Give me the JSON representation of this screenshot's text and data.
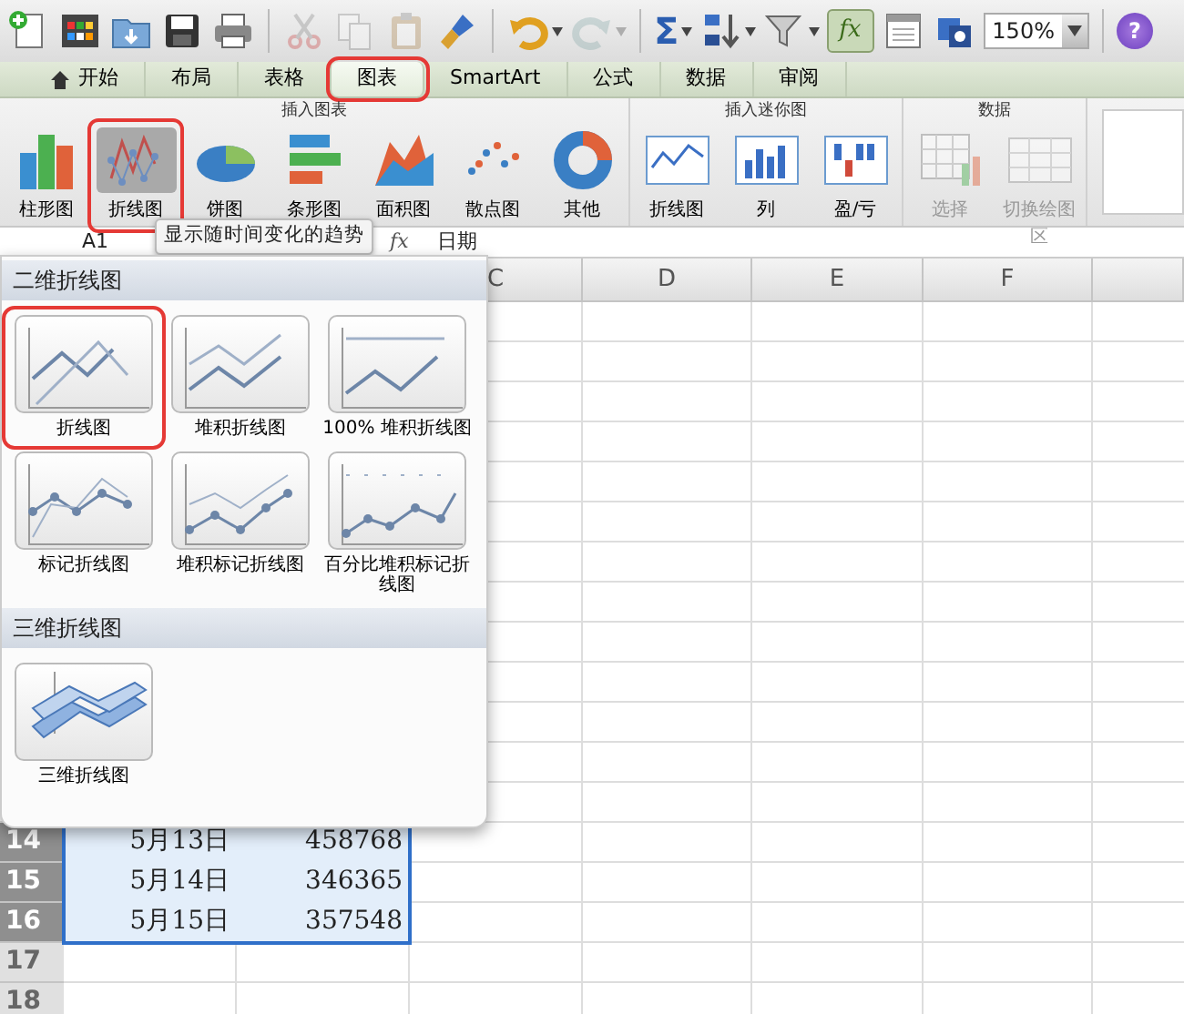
{
  "toolbar": [
    {
      "kind": "icon",
      "disabled": false,
      "dropdown": false
    },
    {
      "kind": "icon",
      "disabled": false,
      "dropdown": false
    },
    {
      "kind": "icon",
      "disabled": false,
      "dropdown": false
    },
    {
      "kind": "icon",
      "disabled": false,
      "dropdown": false
    },
    {
      "kind": "icon",
      "disabled": false,
      "dropdown": false
    },
    {
      "kind": "separator"
    },
    {
      "kind": "icon",
      "disabled": true,
      "dropdown": false
    },
    {
      "kind": "icon",
      "disabled": true,
      "dropdown": false
    },
    {
      "kind": "icon",
      "disabled": true,
      "dropdown": false
    },
    {
      "kind": "icon",
      "disabled": false,
      "dropdown": false
    },
    {
      "kind": "separator"
    },
    {
      "kind": "icon",
      "disabled": false,
      "dropdown": true
    },
    {
      "kind": "icon",
      "disabled": true,
      "dropdown": true
    },
    {
      "kind": "separator"
    },
    {
      "kind": "symbol",
      "text": "Σ",
      "dropdown": true
    },
    {
      "kind": "icon",
      "disabled": false,
      "dropdown": true
    },
    {
      "kind": "icon",
      "disabled": false,
      "dropdown": true
    },
    {
      "kind": "toggle",
      "text": "fx",
      "on": true
    },
    {
      "kind": "icon",
      "disabled": false,
      "dropdown": false
    },
    {
      "kind": "icon",
      "disabled": false,
      "dropdown": false
    },
    {
      "kind": "zoom",
      "value": "150%"
    },
    {
      "kind": "separator"
    },
    {
      "kind": "help",
      "text": "?"
    }
  ],
  "tabs": [
    {
      "label": "开始",
      "selected": false,
      "annotated": false
    },
    {
      "label": "布局",
      "selected": false,
      "annotated": false
    },
    {
      "label": "表格",
      "selected": false,
      "annotated": false
    },
    {
      "label": "图表",
      "selected": true,
      "annotated": true
    },
    {
      "label": "SmartArt",
      "selected": false,
      "annotated": false
    },
    {
      "label": "公式",
      "selected": false,
      "annotated": false
    },
    {
      "label": "数据",
      "selected": false,
      "annotated": false
    },
    {
      "label": "审阅",
      "selected": false,
      "annotated": false
    }
  ],
  "ribbon": {
    "groups": [
      {
        "title": "插入图表",
        "buttons": [
          {
            "label": "柱形图",
            "selected": false,
            "disabled": false,
            "annotated": false
          },
          {
            "label": "折线图",
            "selected": true,
            "disabled": false,
            "annotated": true
          },
          {
            "label": "饼图",
            "selected": false,
            "disabled": false,
            "annotated": false
          },
          {
            "label": "条形图",
            "selected": false,
            "disabled": false,
            "annotated": false
          },
          {
            "label": "面积图",
            "selected": false,
            "disabled": false,
            "annotated": false
          },
          {
            "label": "散点图",
            "selected": false,
            "disabled": false,
            "annotated": false
          },
          {
            "label": "其他",
            "selected": false,
            "disabled": false,
            "annotated": false
          }
        ]
      },
      {
        "title": "插入迷你图",
        "buttons": [
          {
            "label": "折线图",
            "selected": false,
            "disabled": false,
            "annotated": false
          },
          {
            "label": "列",
            "selected": false,
            "disabled": false,
            "annotated": false
          },
          {
            "label": "盈/亏",
            "selected": false,
            "disabled": false,
            "annotated": false
          }
        ]
      },
      {
        "title": "数据",
        "buttons": [
          {
            "label": "选择",
            "selected": false,
            "disabled": true,
            "annotated": false
          },
          {
            "label": "切换绘图区",
            "selected": false,
            "disabled": true,
            "annotated": false
          }
        ]
      }
    ]
  },
  "formula_bar": {
    "cell": "A1",
    "fx": "fx",
    "value": "日期"
  },
  "tooltip": "显示随时间变化的趋势",
  "sheet": {
    "columns": [
      "C",
      "D",
      "E",
      "F"
    ],
    "rows": [
      {
        "number": "14",
        "date": "5月13日",
        "value": "458768",
        "selected": true
      },
      {
        "number": "15",
        "date": "5月14日",
        "value": "346365",
        "selected": true
      },
      {
        "number": "16",
        "date": "5月15日",
        "value": "357548",
        "selected": true
      },
      {
        "number": "17",
        "selected": false
      },
      {
        "number": "18",
        "selected": false
      }
    ]
  },
  "gallery": {
    "sections": [
      {
        "title": "二维折线图",
        "items": [
          {
            "label": "折线图",
            "annotated": true
          },
          {
            "label": "堆积折线图",
            "annotated": false
          },
          {
            "label": "100% 堆积折线图",
            "annotated": false
          },
          {
            "label": "标记折线图",
            "annotated": false
          },
          {
            "label": "堆积标记折线图",
            "annotated": false
          },
          {
            "label": "百分比堆积标记折线图",
            "annotated": false
          }
        ]
      },
      {
        "title": "三维折线图",
        "items": [
          {
            "label": "三维折线图",
            "annotated": false
          }
        ]
      }
    ]
  }
}
